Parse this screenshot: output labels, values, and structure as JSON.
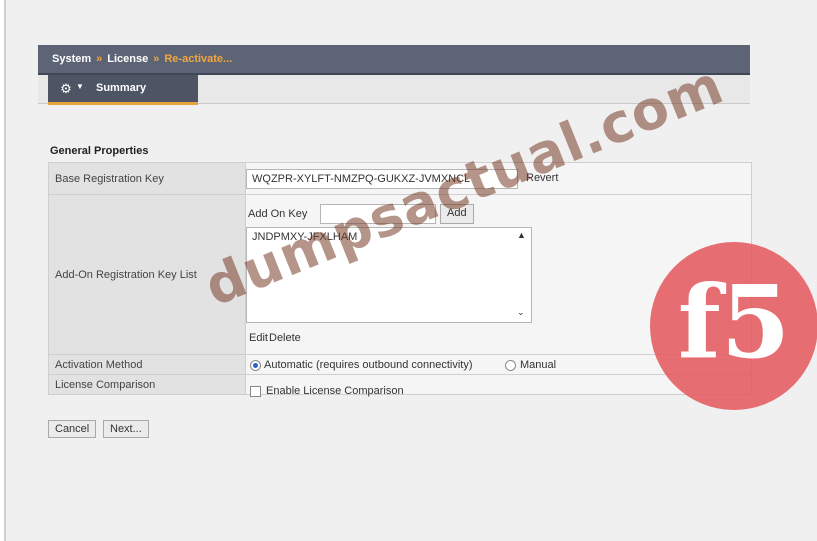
{
  "breadcrumb": {
    "part1": "System",
    "part2": "License",
    "part3": "Re-activate...",
    "sep": "»"
  },
  "tabs": {
    "menu_icon": "gear-icon",
    "active": "Summary"
  },
  "section_title": "General Properties",
  "base_key": {
    "label": "Base Registration Key",
    "value": "WQZPR-XYLFT-NMZPQ-GUKXZ-JVMXNCL",
    "revert": "Revert"
  },
  "addon": {
    "label": "Add-On Registration Key List",
    "key_label": "Add On Key",
    "key_value": "",
    "add_button": "Add",
    "list_items": [
      "JNDPMXY-JFXLHAM"
    ],
    "edit": "Edit",
    "delete": "Delete"
  },
  "activation": {
    "label": "Activation Method",
    "automatic": "Automatic (requires outbound connectivity)",
    "manual": "Manual",
    "selected": "automatic"
  },
  "comparison": {
    "label": "License Comparison",
    "checkbox_text": "Enable License Comparison",
    "checked": false
  },
  "footer": {
    "cancel": "Cancel",
    "next": "Next..."
  },
  "watermark": "dumpsactual.com",
  "logo": "f5",
  "colors": {
    "header": "#5c6475",
    "accent": "#e6a23c",
    "logo": "#e45a5f"
  }
}
